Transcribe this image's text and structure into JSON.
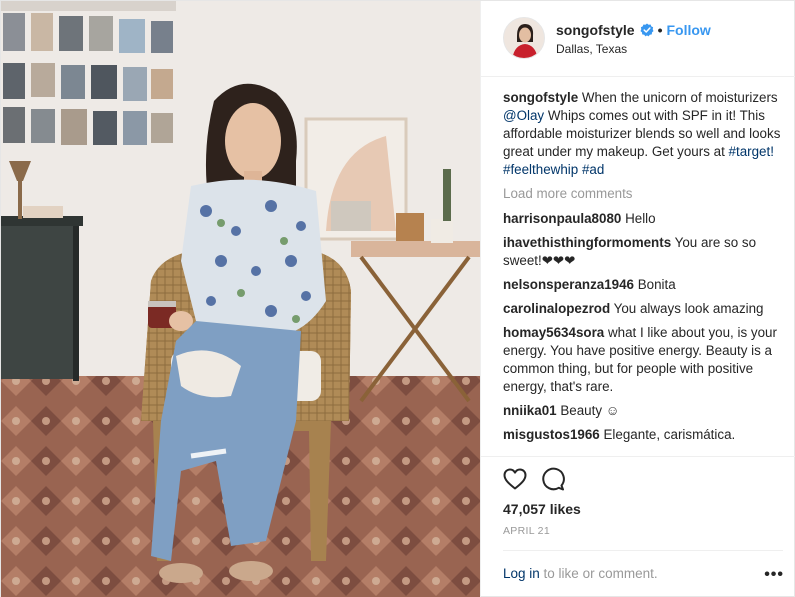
{
  "header": {
    "username": "songofstyle",
    "dot": "•",
    "follow_label": "Follow",
    "location": "Dallas, Texas"
  },
  "caption": {
    "username": "songofstyle",
    "text_1": " When the unicorn of moisturizers ",
    "mention": "@Olay",
    "text_2": " Whips comes out with SPF in it! This affordable moisturizer blends so well and looks great under my makeup. Get yours at ",
    "tag_1": "#target!",
    "tag_2": "#feelthewhip",
    "tag_3": "#ad"
  },
  "load_more": "Load more comments",
  "comments": [
    {
      "user": "harrisonpaula8080",
      "text": "Hello"
    },
    {
      "user": "ihavethisthingformoments",
      "text": "You are so so sweet!❤❤❤"
    },
    {
      "user": "nelsonsperanza1946",
      "text": "Bonita"
    },
    {
      "user": "carolinalopezrod",
      "text": "You always look amazing"
    },
    {
      "user": "homay5634sora",
      "text": "what I like about you, is your energy. You have positive energy. Beauty is a common thing, but for people with positive energy, that's rare."
    },
    {
      "user": "nniika01",
      "text": "Beauty ☺"
    },
    {
      "user": "misgustos1966",
      "text": "Elegante, carismática."
    }
  ],
  "likes": "47,057 likes",
  "date": "APRIL 21",
  "footer": {
    "login_label": "Log in",
    "rest": " to like or comment.",
    "more_label": "•••"
  },
  "icons": {
    "heart": "heart-outline-icon",
    "comment": "speech-bubble-icon",
    "verified": "verified-badge-icon",
    "more": "ellipsis-icon"
  },
  "colors": {
    "link_blue": "#3897f0",
    "hashtag": "#003569",
    "muted": "#999999"
  }
}
